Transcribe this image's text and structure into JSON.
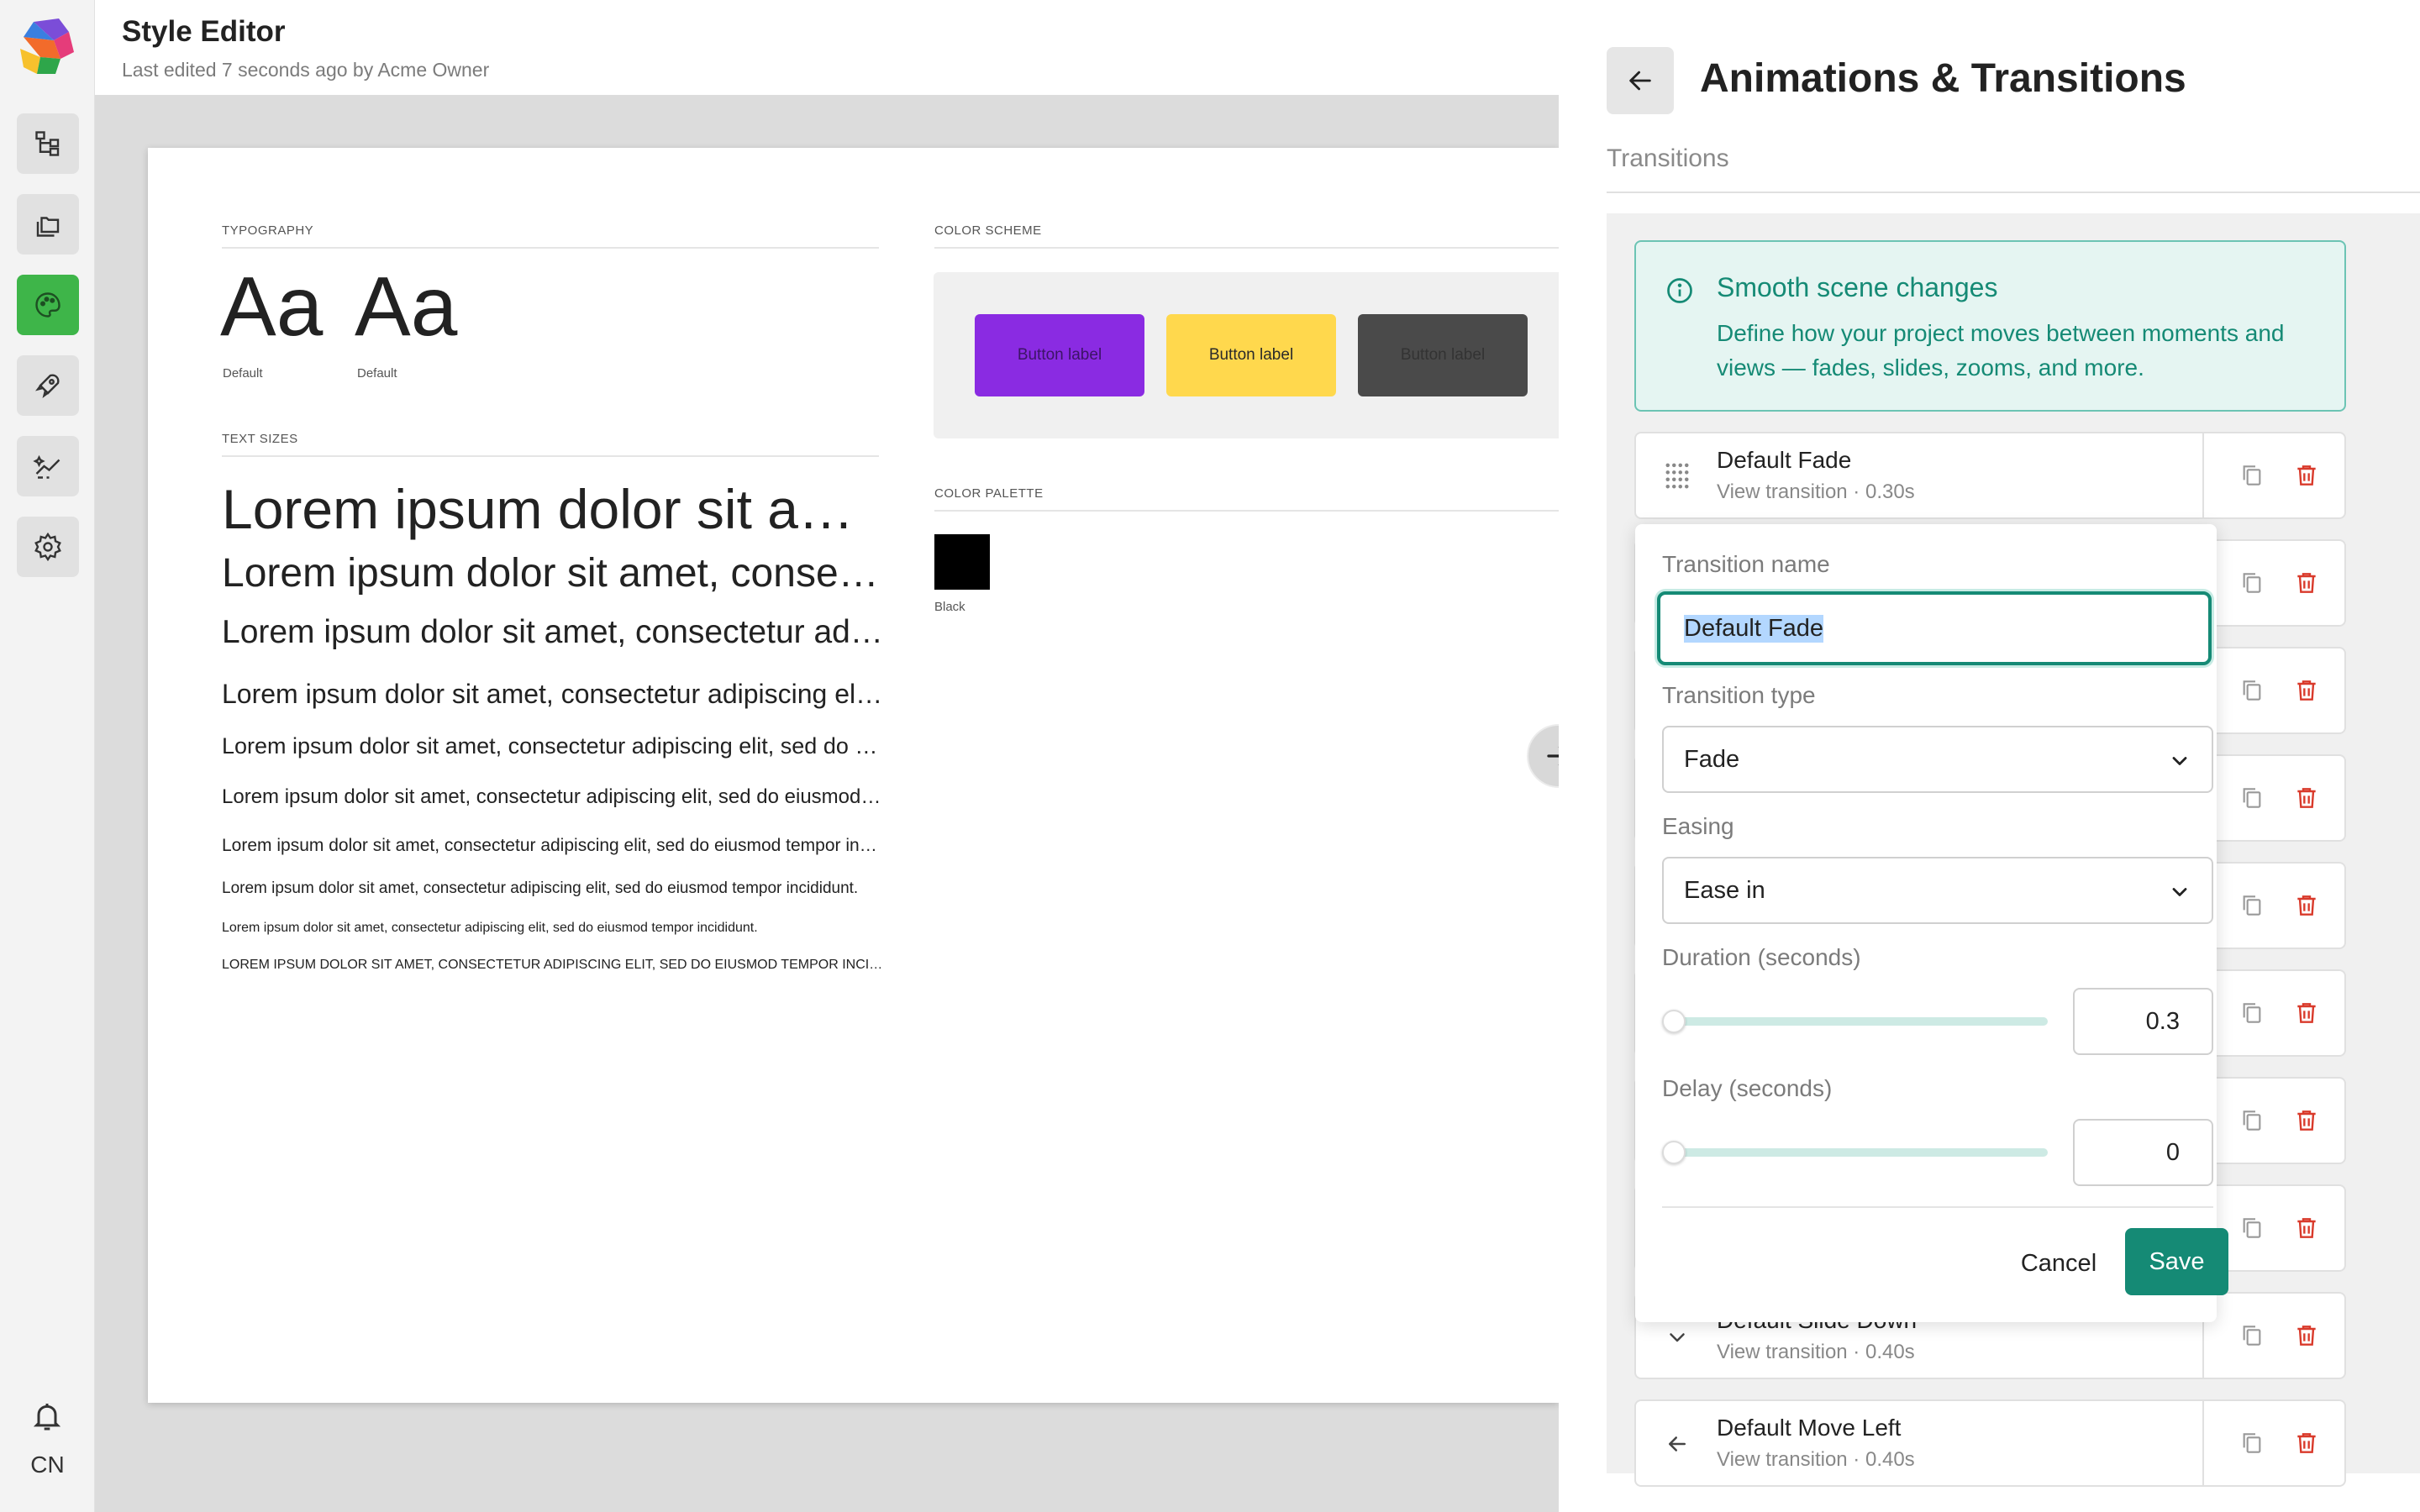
{
  "header": {
    "title": "Style Editor",
    "subtitle": "Last edited 7 seconds ago by Acme Owner"
  },
  "rail": {
    "items": [
      {
        "icon": "hierarchy-icon"
      },
      {
        "icon": "folders-icon"
      },
      {
        "icon": "palette-icon",
        "active": true
      },
      {
        "icon": "rocket-icon"
      },
      {
        "icon": "sparkle-chart-icon"
      },
      {
        "icon": "gear-icon"
      }
    ],
    "user_initials": "CN"
  },
  "canvas": {
    "typography": {
      "label": "TYPOGRAPHY",
      "samples": [
        {
          "text": "Aa",
          "caption": "Default"
        },
        {
          "text": "Aa",
          "caption": "Default"
        }
      ]
    },
    "text_sizes": {
      "label": "TEXT SIZES",
      "lines": [
        "Lorem ipsum dolor sit amet, consectetur adipiscing elit, sed do eiusmod tempor incididunt.",
        "Lorem ipsum dolor sit amet, consectetur adipiscing elit, sed do eiusmod tempor incididunt.",
        "Lorem ipsum dolor sit amet, consectetur adipiscing elit, sed do eiusmod tempor incididunt.",
        "Lorem ipsum dolor sit amet, consectetur adipiscing elit, sed do eiusmod tempor incididunt.",
        "Lorem ipsum dolor sit amet, consectetur adipiscing elit, sed do eiusmod tempor incididunt.",
        "Lorem ipsum dolor sit amet, consectetur adipiscing elit, sed do eiusmod tempor incididunt.",
        "Lorem ipsum dolor sit amet, consectetur adipiscing elit, sed do eiusmod tempor incididunt.",
        "Lorem ipsum dolor sit amet, consectetur adipiscing elit, sed do eiusmod tempor incididunt.",
        "Lorem ipsum dolor sit amet, consectetur adipiscing elit, sed do eiusmod tempor incididunt.",
        "LOREM IPSUM DOLOR SIT AMET, CONSECTETUR ADIPISCING ELIT, SED DO EIUSMOD TEMPOR INCIDIDUNT."
      ]
    },
    "color_scheme": {
      "label": "COLOR SCHEME",
      "buttons": [
        {
          "label": "Button label",
          "bg": "#8a2be2",
          "fg": "#3c1466"
        },
        {
          "label": "Button label",
          "bg": "#ffd84d",
          "fg": "#2a2a2a"
        },
        {
          "label": "Button label",
          "bg": "#4a4a4a",
          "fg": "#333333"
        }
      ]
    },
    "color_palette": {
      "label": "COLOR PALETTE",
      "swatches": [
        {
          "name": "Black",
          "color": "#000000"
        }
      ]
    }
  },
  "panel": {
    "title": "Animations & Transitions",
    "section": "Transitions",
    "info": {
      "title": "Smooth scene changes",
      "body": "Define how your project moves between moments and views — fades, slides, zooms, and more."
    },
    "transitions": [
      {
        "name": "Default Fade",
        "meta": "View transition · 0.30s",
        "icon": "grid-dots-icon"
      },
      {
        "name": "Default Slide Down",
        "meta": "View transition · 0.40s",
        "icon": "chevron-down-icon"
      },
      {
        "name": "Default Move Left",
        "meta": "View transition · 0.40s",
        "icon": "arrow-left-icon"
      }
    ],
    "editor": {
      "name_label": "Transition name",
      "name_value": "Default Fade",
      "type_label": "Transition type",
      "type_value": "Fade",
      "easing_label": "Easing",
      "easing_value": "Ease in",
      "duration_label": "Duration (seconds)",
      "duration_value": "0.3",
      "duration_fraction": 0.0,
      "delay_label": "Delay (seconds)",
      "delay_value": "0",
      "delay_fraction": 0.0,
      "cancel_label": "Cancel",
      "save_label": "Save"
    }
  },
  "colors": {
    "accent": "#158a75",
    "active_rail": "#3eb549",
    "danger": "#d93a2b"
  }
}
